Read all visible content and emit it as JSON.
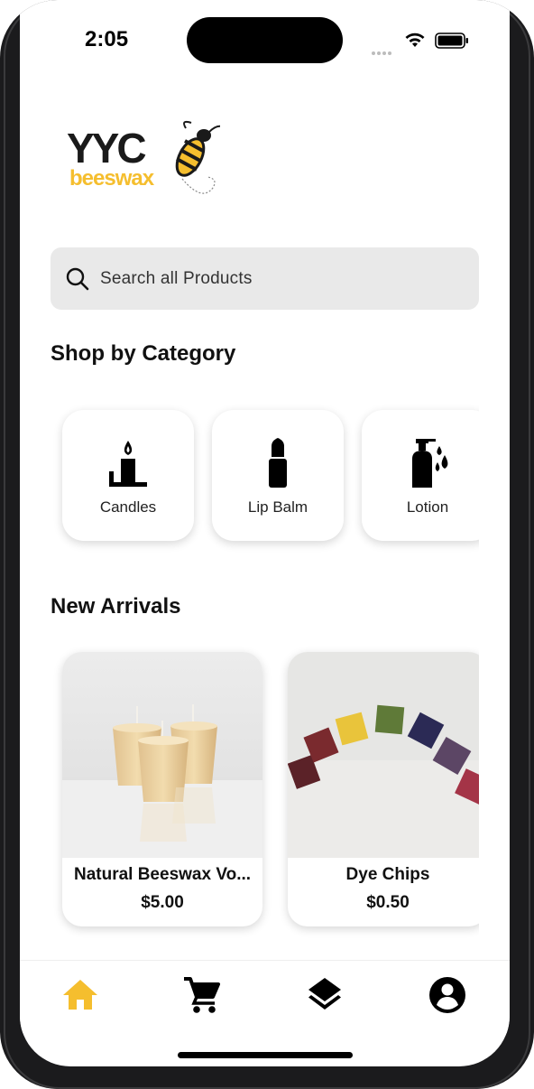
{
  "status_bar": {
    "time": "2:05"
  },
  "brand": {
    "logo_text_main": "YYC",
    "logo_text_sub": "beeswax",
    "accent_color": "#F5BE2E"
  },
  "search": {
    "placeholder": "Search all Products",
    "value": ""
  },
  "categories_section": {
    "title": "Shop by Category",
    "items": [
      {
        "label": "Candles",
        "icon": "candle-icon"
      },
      {
        "label": "Lip Balm",
        "icon": "lipstick-icon"
      },
      {
        "label": "Lotion",
        "icon": "lotion-bottle-icon"
      }
    ]
  },
  "new_arrivals": {
    "title": "New Arrivals",
    "items": [
      {
        "name": "Natural Beeswax Vo...",
        "price": "$5.00",
        "image": "votive-candles-photo"
      },
      {
        "name": "Dye Chips",
        "price": "$0.50",
        "image": "dye-chips-photo"
      }
    ]
  },
  "tab_bar": {
    "active_color": "#F5BE2E",
    "items": [
      {
        "icon": "home-icon",
        "active": true
      },
      {
        "icon": "cart-icon",
        "active": false
      },
      {
        "icon": "layers-icon",
        "active": false
      },
      {
        "icon": "account-icon",
        "active": false
      }
    ]
  }
}
